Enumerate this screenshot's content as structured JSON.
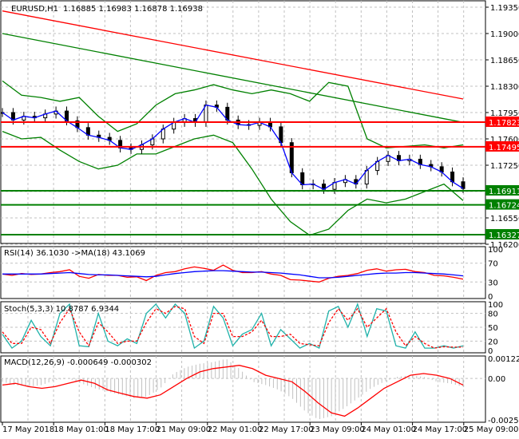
{
  "header": {
    "title": "EURUSD,H1",
    "ohlc": "1.16885 1.16983 1.16878 1.16938"
  },
  "colors": {
    "up": "#000000",
    "bull_ma": "#ff0000",
    "ma_slow": "#008000",
    "rsi": "#ff0000",
    "rsi_ma": "#0000ff",
    "stoch_main": "#20b2aa",
    "stoch_signal": "#ff0000",
    "macd": "#ff0000",
    "hist": "#c0c0c0"
  },
  "chart_data": [
    {
      "type": "line",
      "title": "EURUSD,H1",
      "ylim": [
        1.162,
        1.1935
      ],
      "yticks": [
        "1.19350",
        "1.19000",
        "1.18650",
        "1.18300",
        "1.17950",
        "1.17600",
        "1.17250",
        "1.16900",
        "1.16550",
        "1.16200"
      ],
      "xticks": [
        "17 May 2018",
        "18 May 01:00",
        "18 May 17:00",
        "21 May 09:00",
        "22 May 01:00",
        "22 May 17:00",
        "23 May 09:00",
        "24 May 01:00",
        "24 May 17:00",
        "25 May 09:00"
      ],
      "levels": [
        {
          "label": "1.17823",
          "value": 1.17823,
          "color": "#ff0000"
        },
        {
          "label": "1.17495",
          "value": 1.17495,
          "color": "#ff0000"
        },
        {
          "label": "1.16911",
          "value": 1.16911,
          "color": "#008000"
        },
        {
          "label": "1.16724",
          "value": 1.16724,
          "color": "#008000"
        },
        {
          "label": "1.16327",
          "value": 1.16327,
          "color": "#008000"
        }
      ],
      "close": [
        1.1795,
        1.1785,
        1.179,
        1.1788,
        1.1793,
        1.1797,
        1.1784,
        1.1775,
        1.1765,
        1.1762,
        1.1758,
        1.1748,
        1.1746,
        1.1752,
        1.176,
        1.1773,
        1.1782,
        1.1787,
        1.1782,
        1.1805,
        1.1802,
        1.1785,
        1.1779,
        1.1778,
        1.1782,
        1.1776,
        1.1755,
        1.1715,
        1.1699,
        1.17,
        1.1693,
        1.1702,
        1.1706,
        1.17,
        1.1718,
        1.173,
        1.1738,
        1.1731,
        1.1733,
        1.1726,
        1.1723,
        1.1716,
        1.1703,
        1.1694
      ],
      "ma_red": [
        1.193,
        1.1813
      ],
      "ma_green": [
        1.19,
        1.1782
      ],
      "bb_upper": [
        1.1837,
        1.1818,
        1.1815,
        1.181,
        1.1815,
        1.179,
        1.177,
        1.178,
        1.1805,
        1.182,
        1.1825,
        1.1832,
        1.1825,
        1.182,
        1.1825,
        1.182,
        1.181,
        1.1835,
        1.183,
        1.176,
        1.1748,
        1.175,
        1.1752,
        1.1748,
        1.1752
      ],
      "bb_lower": [
        1.177,
        1.176,
        1.1762,
        1.1745,
        1.173,
        1.172,
        1.1725,
        1.174,
        1.174,
        1.175,
        1.176,
        1.1765,
        1.1755,
        1.172,
        1.168,
        1.165,
        1.1632,
        1.164,
        1.1665,
        1.168,
        1.1675,
        1.168,
        1.169,
        1.17,
        1.1678
      ]
    },
    {
      "type": "line",
      "title": "RSI(14) 36.1030  ->MA(18) 43.1069",
      "ylim": [
        0,
        100
      ],
      "yticks": [
        "100",
        "70",
        "30",
        "0"
      ],
      "rsi": [
        47,
        44,
        48,
        46,
        47,
        50,
        52,
        56,
        42,
        38,
        46,
        44,
        44,
        40,
        41,
        33,
        44,
        50,
        52,
        58,
        62,
        59,
        55,
        66,
        55,
        50,
        50,
        52,
        47,
        44,
        35,
        34,
        32,
        30,
        38,
        42,
        44,
        48,
        55,
        58,
        53,
        56,
        57,
        52,
        50,
        44,
        43,
        40,
        36
      ],
      "ma": [
        47,
        47,
        47,
        47,
        47,
        48,
        49,
        50,
        48,
        46,
        45,
        45,
        44,
        43,
        42,
        41,
        42,
        45,
        48,
        50,
        52,
        53,
        54,
        54,
        53,
        52,
        51,
        51,
        50,
        49,
        47,
        45,
        42,
        39,
        39,
        40,
        42,
        44,
        46,
        48,
        49,
        49,
        50,
        50,
        49,
        48,
        47,
        45,
        43
      ]
    },
    {
      "type": "line",
      "title": "Stoch(5,3,3) 10.8787 6.9344",
      "ylim": [
        0,
        100
      ],
      "yticks": [
        "100",
        "80",
        "50",
        "20",
        "0"
      ],
      "main": [
        35,
        5,
        20,
        65,
        30,
        10,
        80,
        100,
        10,
        8,
        80,
        20,
        10,
        25,
        15,
        80,
        100,
        70,
        100,
        80,
        5,
        20,
        95,
        70,
        10,
        35,
        45,
        80,
        10,
        45,
        25,
        5,
        15,
        5,
        85,
        95,
        50,
        100,
        30,
        90,
        85,
        10,
        5,
        40,
        5,
        5,
        10,
        5,
        10
      ],
      "signal": [
        40,
        15,
        15,
        50,
        45,
        15,
        60,
        90,
        40,
        10,
        60,
        40,
        15,
        20,
        20,
        60,
        90,
        80,
        95,
        90,
        30,
        15,
        80,
        80,
        30,
        30,
        40,
        65,
        30,
        30,
        35,
        15,
        12,
        10,
        60,
        90,
        65,
        90,
        50,
        70,
        90,
        40,
        10,
        30,
        15,
        5,
        8,
        7,
        7
      ]
    },
    {
      "type": "bar",
      "title": "MACD(12,26,9) -0.000649 -0.000302",
      "ylim": [
        -0.002523,
        0.001225
      ],
      "yticks": [
        "0.001225",
        "0.00",
        "-0.002523"
      ],
      "macd": [
        -0.0004,
        -0.0003,
        -0.0005,
        -0.0006,
        -0.0005,
        -0.0003,
        -0.0001,
        -0.0003,
        -0.0007,
        -0.0009,
        -0.0011,
        -0.0012,
        -0.001,
        -0.0005,
        0.0,
        0.0004,
        0.0006,
        0.0007,
        0.0008,
        0.0006,
        0.0002,
        0.0,
        -0.0002,
        -0.0008,
        -0.0015,
        -0.0021,
        -0.0023,
        -0.0018,
        -0.0012,
        -0.0006,
        -0.0002,
        0.0002,
        0.0003,
        0.0002,
        0.0,
        -0.0004
      ],
      "hist": [
        -0.0002,
        -0.0004,
        -0.0005,
        -0.0004,
        -0.0001,
        0.0,
        -0.0003,
        -0.0006,
        -0.0008,
        -0.001,
        -0.0012,
        -0.0011,
        -0.0006,
        0.0003,
        0.0007,
        0.0009,
        0.001,
        0.0012,
        0.0006,
        -0.0002,
        -0.0004,
        -0.0007,
        -0.0012,
        -0.002,
        -0.0025,
        -0.0023,
        -0.0018,
        -0.0012,
        -0.0006,
        -0.0002,
        0.0001,
        0.0002,
        0.0001,
        -0.0002,
        -0.0003,
        -0.0005
      ]
    }
  ]
}
